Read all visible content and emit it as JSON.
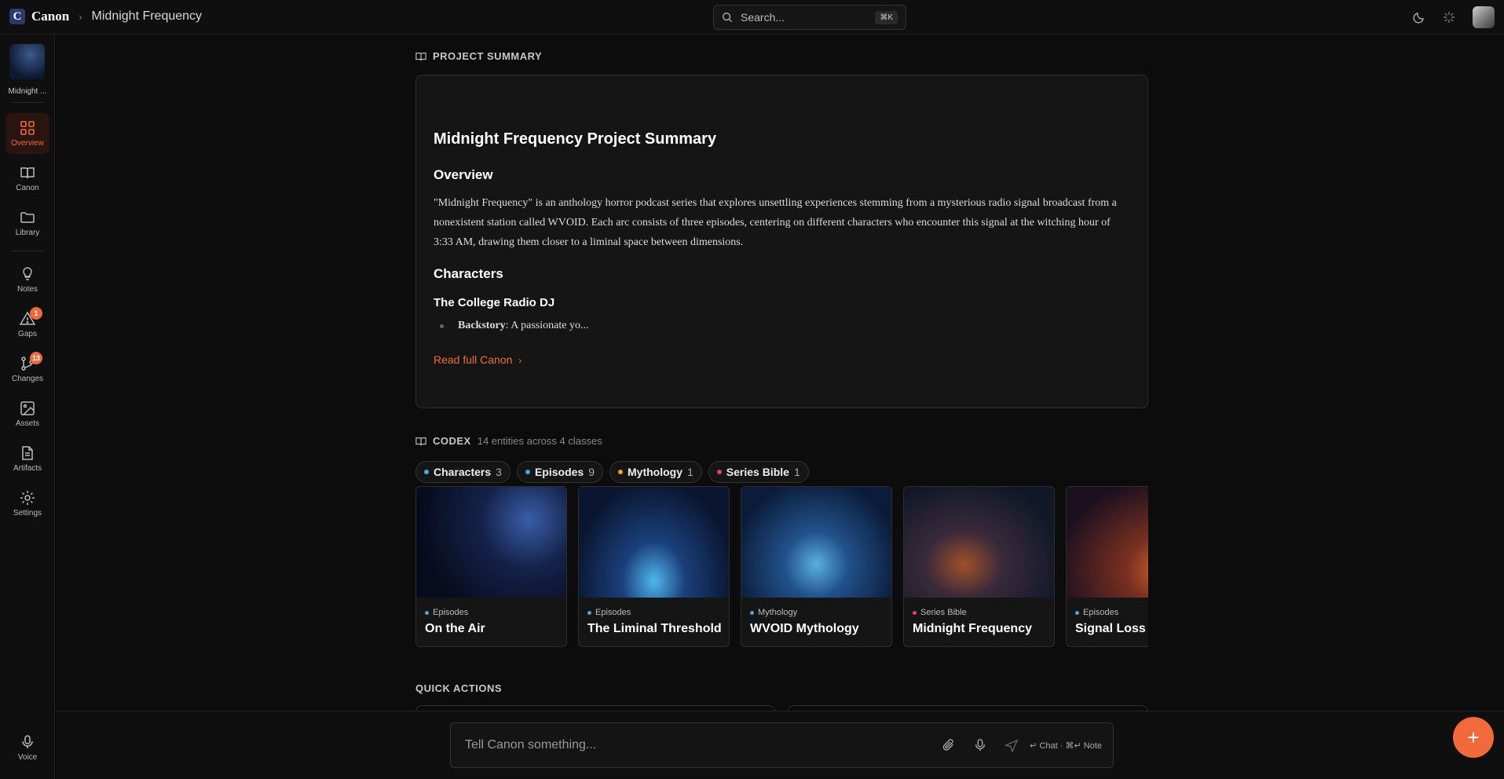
{
  "topbar": {
    "app_name": "Canon",
    "logo_letter": "C",
    "breadcrumb_separator": "›",
    "project_name": "Midnight Frequency",
    "search_placeholder": "Search...",
    "search_shortcut": "⌘K"
  },
  "sidebar": {
    "project_label": "Midnight ...",
    "items": [
      {
        "label": "Overview",
        "icon": "grid-icon",
        "active": true
      },
      {
        "label": "Canon",
        "icon": "book-icon"
      },
      {
        "label": "Library",
        "icon": "folder-icon"
      },
      {
        "label": "Notes",
        "icon": "lightbulb-icon"
      },
      {
        "label": "Gaps",
        "icon": "warning-icon",
        "badge": "1"
      },
      {
        "label": "Changes",
        "icon": "git-branch-icon",
        "badge": "13"
      },
      {
        "label": "Assets",
        "icon": "image-icon"
      },
      {
        "label": "Artifacts",
        "icon": "document-icon"
      },
      {
        "label": "Settings",
        "icon": "gear-icon"
      }
    ],
    "voice_label": "Voice"
  },
  "summary": {
    "section_label": "PROJECT SUMMARY",
    "title": "Midnight Frequency Project Summary",
    "overview_heading": "Overview",
    "overview_text": "\"Midnight Frequency\" is an anthology horror podcast series that explores unsettling experiences stemming from a mysterious radio signal broadcast from a nonexistent station called WVOID. Each arc consists of three episodes, centering on different characters who encounter this signal at the witching hour of 3:33 AM, drawing them closer to a liminal space between dimensions.",
    "characters_heading": "Characters",
    "character_name": "The College Radio DJ",
    "bullet_label": "Backstory",
    "bullet_text": ": A passionate yo...",
    "read_more": "Read full Canon"
  },
  "codex": {
    "section_label": "CODEX",
    "subtitle": "14 entities across 4 classes",
    "chips": [
      {
        "label": "Characters",
        "count": "3",
        "color": "#4aa3df"
      },
      {
        "label": "Episodes",
        "count": "9",
        "color": "#4aa3df"
      },
      {
        "label": "Mythology",
        "count": "1",
        "color": "#f0a030"
      },
      {
        "label": "Series Bible",
        "count": "1",
        "color": "#e0455a"
      }
    ],
    "cards": [
      {
        "category": "Episodes",
        "name": "On the Air",
        "color": "#4aa3df"
      },
      {
        "category": "Episodes",
        "name": "The Liminal Threshold",
        "color": "#4aa3df"
      },
      {
        "category": "Mythology",
        "name": "WVOID Mythology",
        "color": "#4aa3df"
      },
      {
        "category": "Series Bible",
        "name": "Midnight Frequency",
        "color": "#e0455a"
      },
      {
        "category": "Episodes",
        "name": "Signal Loss",
        "color": "#4aa3df"
      }
    ]
  },
  "quick_actions": {
    "label": "QUICK ACTIONS"
  },
  "composer": {
    "placeholder": "Tell Canon something...",
    "hint": "↵ Chat · ⌘↵ Note"
  },
  "fab": {
    "label": "+"
  }
}
